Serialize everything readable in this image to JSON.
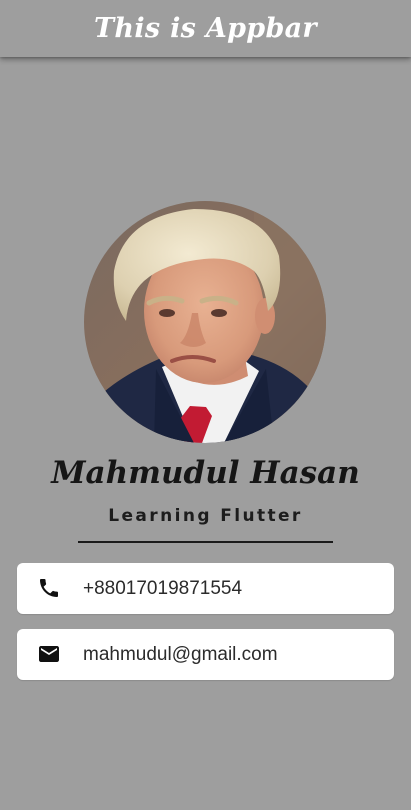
{
  "appbar": {
    "title": "This is Appbar"
  },
  "profile": {
    "avatar_icon": "profile-photo",
    "name": "Mahmudul Hasan",
    "subtitle": "Learning Flutter"
  },
  "contacts": {
    "phone": {
      "icon": "phone-icon",
      "value": "+88017019871554"
    },
    "email": {
      "icon": "mail-icon",
      "value": "mahmudul@gmail.com"
    }
  },
  "colors": {
    "background": "#9e9e9e",
    "appbar": "#9e9e9e",
    "card": "#ffffff",
    "text_dark": "#161616"
  }
}
